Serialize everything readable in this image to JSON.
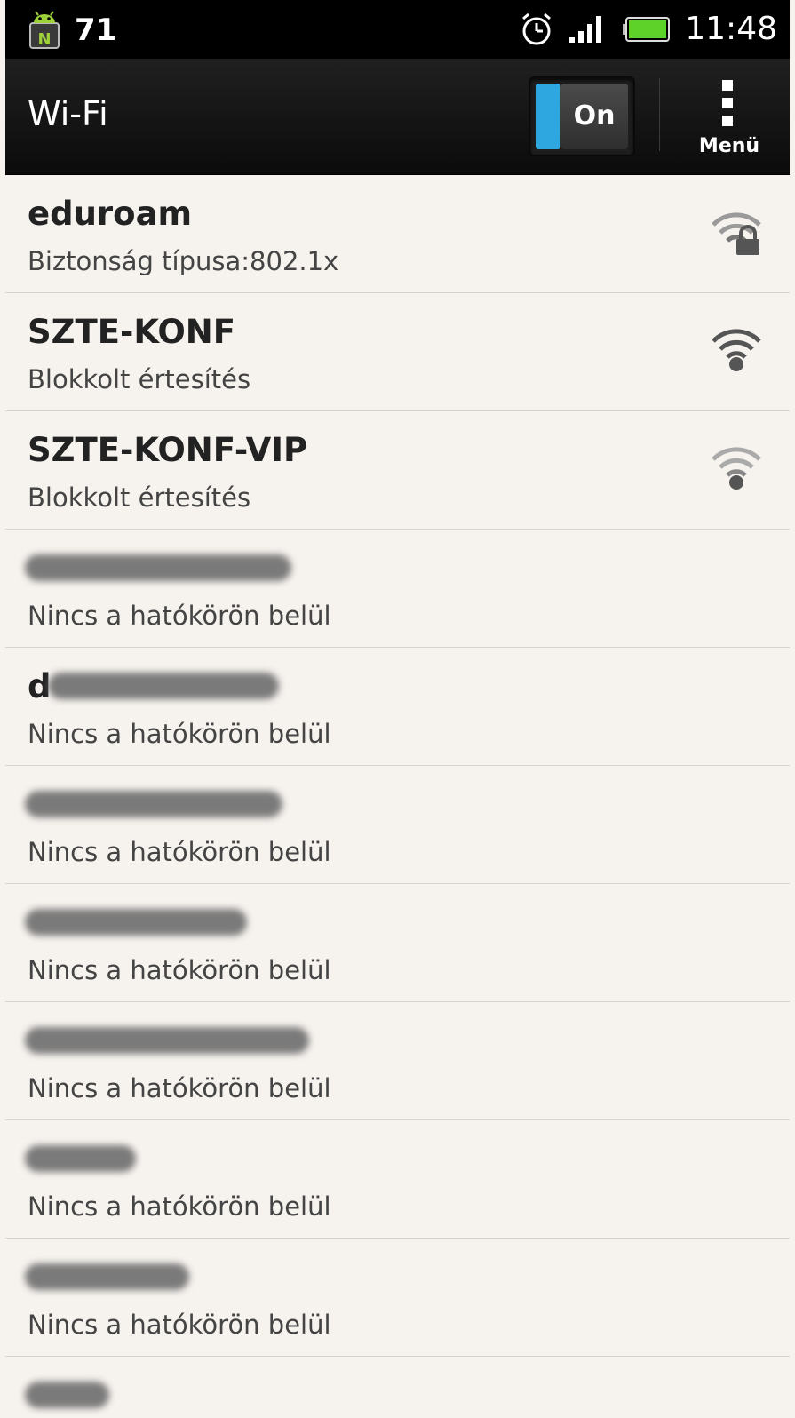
{
  "statusbar": {
    "notification_count": "71",
    "time": "11:48"
  },
  "actionbar": {
    "title": "Wi-Fi",
    "toggle_label": "On",
    "menu_label": "Menü"
  },
  "networks": [
    {
      "name": "eduroam",
      "status": "Biztonság típusa:802.1x",
      "signal_icon": "wifi-lock-icon"
    },
    {
      "name": "SZTE-KONF",
      "status": "Blokkolt értesítés",
      "signal_icon": "wifi-icon"
    },
    {
      "name": "SZTE-KONF-VIP",
      "status": "Blokkolt értesítés",
      "signal_icon": "wifi-icon"
    },
    {
      "name": "",
      "status": "Nincs a hatókörön belül"
    },
    {
      "name": "d",
      "status": "Nincs a hatókörön belül"
    },
    {
      "name": "",
      "status": "Nincs a hatókörön belül"
    },
    {
      "name": "",
      "status": "Nincs a hatókörön belül"
    },
    {
      "name": "",
      "status": "Nincs a hatókörön belül"
    },
    {
      "name": "",
      "status": "Nincs a hatókörön belül"
    },
    {
      "name": "",
      "status": "Nincs a hatókörön belül"
    },
    {
      "name": "",
      "status": ""
    }
  ],
  "colors": {
    "accent": "#2ea7e0",
    "list_background": "#f6f2ee",
    "bar_background": "#111111"
  }
}
